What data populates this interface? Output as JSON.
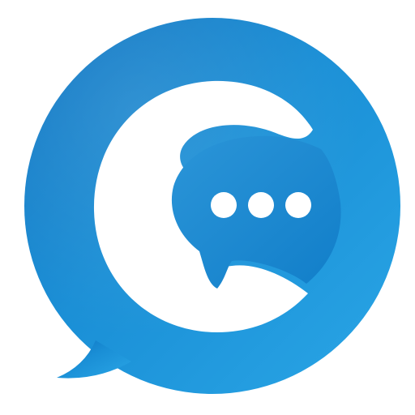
{
  "logo": {
    "icon": "chat-bubble-logo-icon",
    "colors": {
      "bubble_light": "#2aa6e6",
      "bubble_mid": "#1a8fd6",
      "bubble_dark": "#0d72c0",
      "glyph": "#ffffff",
      "inner_bubble": "#1886cf",
      "dot": "#ffffff"
    },
    "typing_dots": 3
  }
}
